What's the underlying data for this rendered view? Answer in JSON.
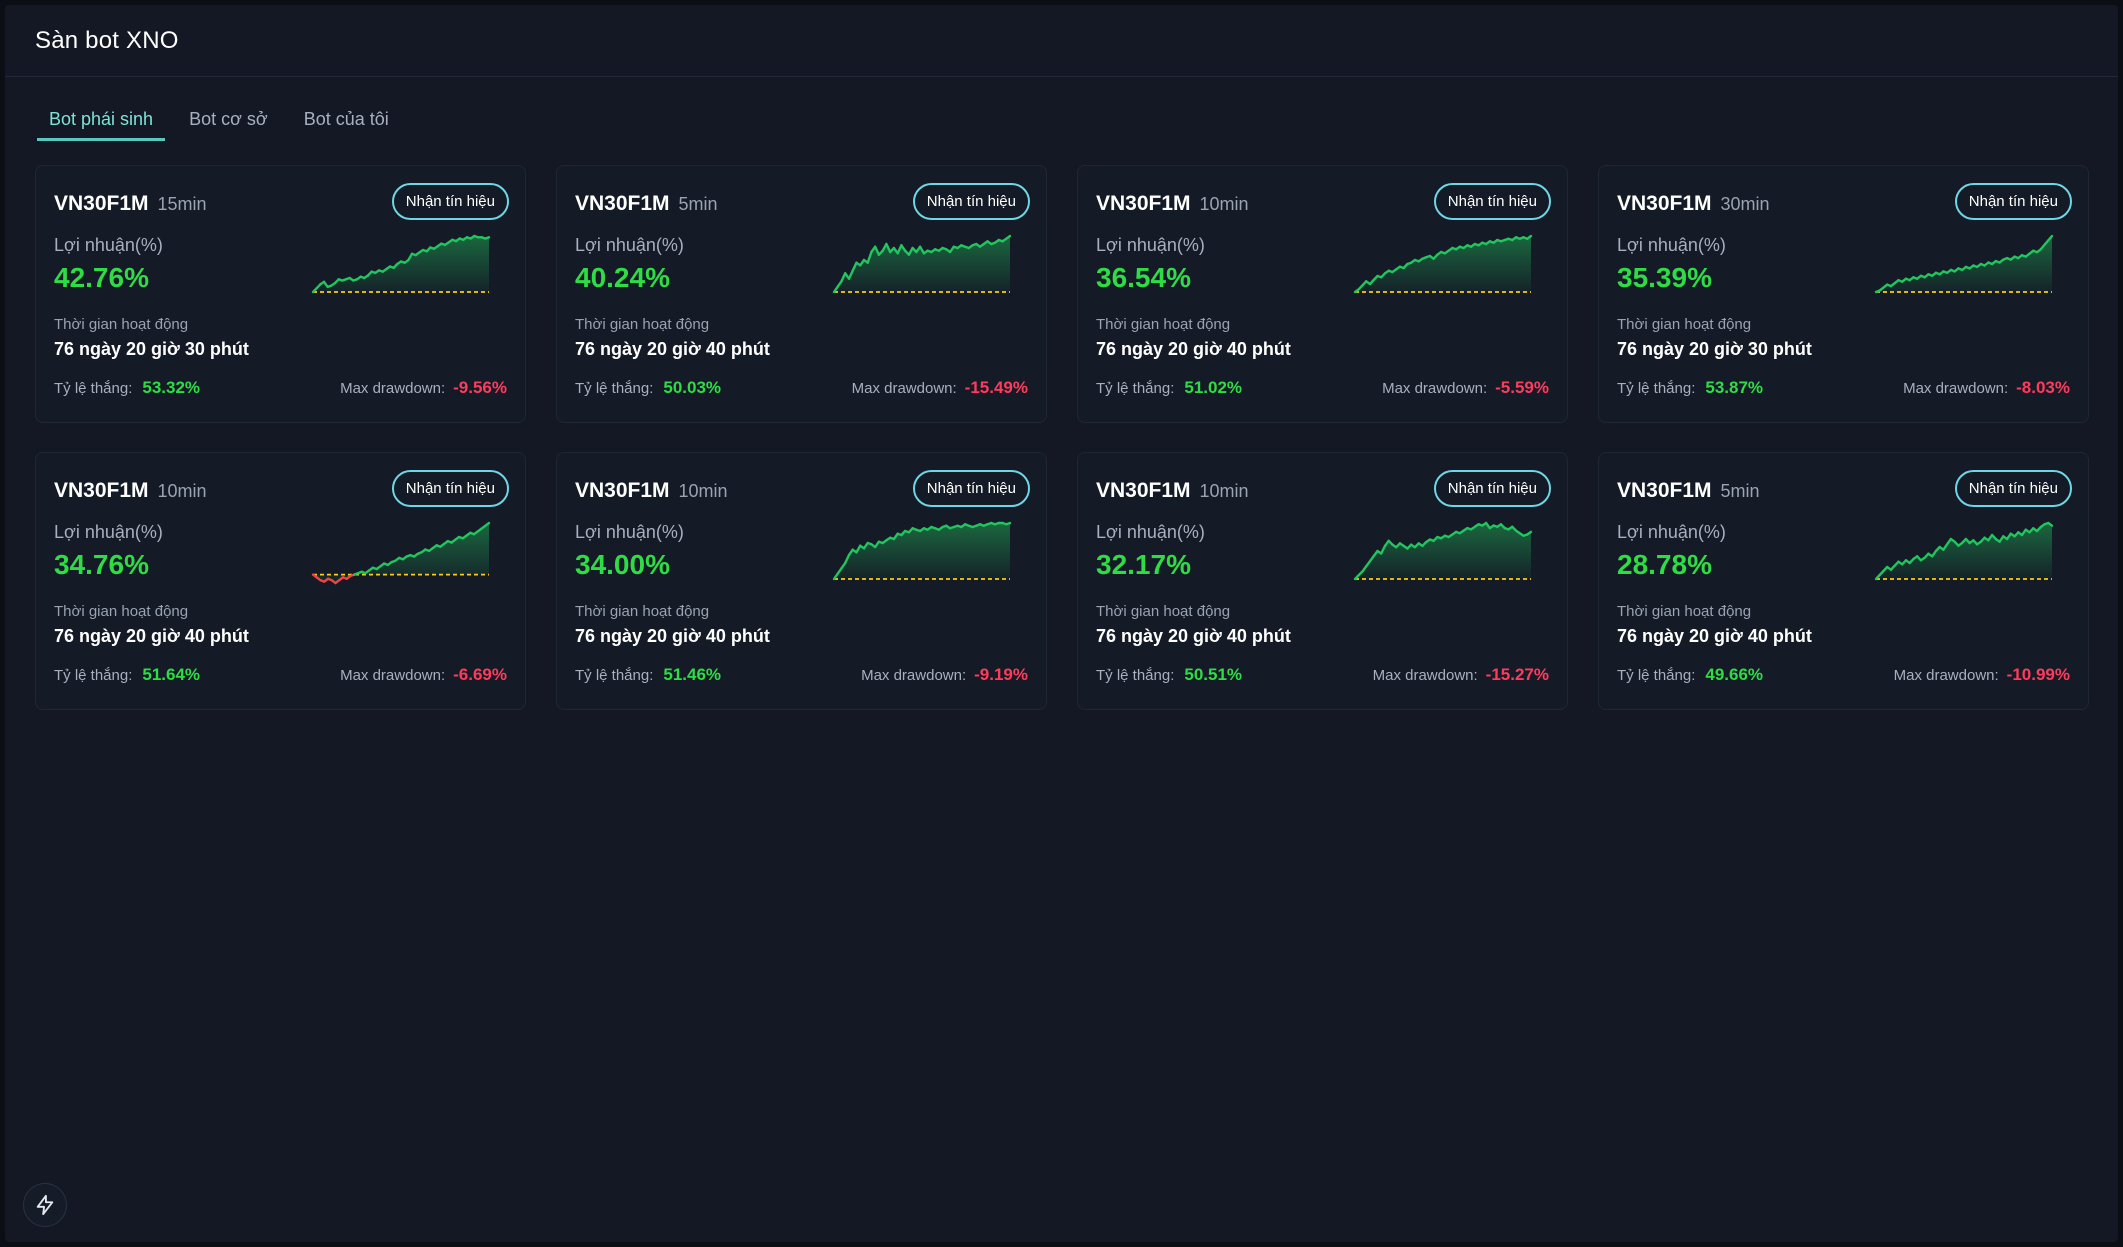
{
  "header": {
    "title": "Sàn bot XNO"
  },
  "tabs": [
    {
      "label": "Bot phái sinh",
      "active": true
    },
    {
      "label": "Bot cơ sở",
      "active": false
    },
    {
      "label": "Bot của tôi",
      "active": false
    }
  ],
  "labels": {
    "signal_button": "Nhận tín hiệu",
    "profit": "Lợi nhuận(%)",
    "runtime": "Thời gian hoạt động",
    "win_rate": "Tỷ lệ thắng:",
    "max_drawdown": "Max drawdown:"
  },
  "colors": {
    "profit_positive": "#2fdc45",
    "drawdown": "#ff3b5c",
    "tab_active": "#7fe3d8",
    "button_border": "#6fd6e6",
    "sparkline_up": "#22c55e",
    "sparkline_down": "#ef4444",
    "baseline": "#facc15"
  },
  "bots": [
    {
      "symbol": "VN30F1M",
      "interval": "15min",
      "profit": "42.76%",
      "runtime": "76 ngày 20 giờ 30 phút",
      "win_rate": "53.32%",
      "max_drawdown": "-9.56%",
      "spark": [
        0,
        3,
        6,
        8,
        4,
        5,
        7,
        10,
        9,
        10,
        11,
        9,
        10,
        12,
        11,
        13,
        16,
        15,
        17,
        16,
        18,
        20,
        19,
        22,
        24,
        23,
        25,
        30,
        29,
        31,
        33,
        32,
        35,
        34,
        36,
        38,
        37,
        39,
        41,
        40,
        42,
        41,
        43,
        42,
        44,
        43,
        43,
        42,
        43
      ]
    },
    {
      "symbol": "VN30F1M",
      "interval": "5min",
      "profit": "40.24%",
      "runtime": "76 ngày 20 giờ 40 phút",
      "win_rate": "50.03%",
      "max_drawdown": "-15.49%",
      "spark": [
        0,
        4,
        8,
        14,
        10,
        16,
        22,
        20,
        24,
        22,
        30,
        34,
        28,
        31,
        36,
        30,
        33,
        29,
        35,
        31,
        28,
        33,
        30,
        34,
        29,
        31,
        30,
        32,
        31,
        33,
        32,
        30,
        34,
        33,
        35,
        34,
        33,
        35,
        36,
        34,
        36,
        38,
        36,
        37,
        39,
        38,
        40,
        42
      ]
    },
    {
      "symbol": "VN30F1M",
      "interval": "10min",
      "profit": "36.54%",
      "runtime": "76 ngày 20 giờ 40 phút",
      "win_rate": "51.02%",
      "max_drawdown": "-5.59%",
      "spark": [
        0,
        2,
        5,
        8,
        6,
        9,
        12,
        11,
        14,
        16,
        15,
        17,
        19,
        18,
        21,
        22,
        24,
        23,
        25,
        26,
        27,
        25,
        28,
        30,
        29,
        31,
        33,
        32,
        34,
        33,
        35,
        34,
        36,
        35,
        37,
        36,
        38,
        37,
        39,
        38,
        39,
        40,
        39,
        41,
        40,
        41,
        40,
        42
      ]
    },
    {
      "symbol": "VN30F1M",
      "interval": "30min",
      "profit": "35.39%",
      "runtime": "76 ngày 20 giờ 30 phút",
      "win_rate": "53.87%",
      "max_drawdown": "-8.03%",
      "spark": [
        0,
        1,
        3,
        5,
        4,
        6,
        8,
        7,
        9,
        8,
        10,
        9,
        11,
        10,
        12,
        11,
        13,
        12,
        14,
        13,
        15,
        14,
        16,
        15,
        17,
        16,
        18,
        17,
        19,
        18,
        20,
        19,
        21,
        20,
        22,
        23,
        22,
        24,
        23,
        25,
        24,
        26,
        28,
        27,
        29,
        32,
        35,
        38
      ]
    },
    {
      "symbol": "VN30F1M",
      "interval": "10min",
      "profit": "34.76%",
      "runtime": "76 ngày 20 giờ 40 phút",
      "win_rate": "51.64%",
      "max_drawdown": "-6.69%",
      "spark": [
        0,
        -2,
        -4,
        -5,
        -3,
        -4,
        -6,
        -4,
        -2,
        -3,
        -1,
        0,
        1,
        2,
        1,
        3,
        5,
        4,
        6,
        8,
        7,
        9,
        10,
        12,
        11,
        13,
        14,
        13,
        15,
        16,
        18,
        17,
        19,
        21,
        20,
        22,
        24,
        23,
        25,
        27,
        26,
        28,
        30,
        29,
        31,
        33,
        35,
        37
      ]
    },
    {
      "symbol": "VN30F1M",
      "interval": "10min",
      "profit": "34.00%",
      "runtime": "76 ngày 20 giờ 40 phút",
      "win_rate": "51.46%",
      "max_drawdown": "-9.19%",
      "spark": [
        0,
        4,
        8,
        12,
        18,
        22,
        20,
        25,
        23,
        27,
        26,
        24,
        28,
        27,
        29,
        31,
        30,
        34,
        33,
        36,
        35,
        38,
        37,
        36,
        38,
        37,
        39,
        38,
        37,
        39,
        40,
        38,
        39,
        40,
        39,
        41,
        40,
        39,
        40,
        41,
        40,
        41,
        42,
        41,
        42,
        42,
        41,
        42
      ]
    },
    {
      "symbol": "VN30F1M",
      "interval": "10min",
      "profit": "32.17%",
      "runtime": "76 ngày 20 giờ 40 phút",
      "win_rate": "50.51%",
      "max_drawdown": "-15.27%",
      "spark": [
        0,
        3,
        6,
        10,
        14,
        18,
        22,
        20,
        26,
        30,
        27,
        25,
        28,
        26,
        24,
        27,
        25,
        28,
        26,
        29,
        31,
        30,
        33,
        32,
        34,
        33,
        35,
        37,
        36,
        38,
        40,
        39,
        41,
        43,
        42,
        44,
        40,
        42,
        41,
        43,
        40,
        39,
        41,
        38,
        36,
        34,
        35,
        37
      ]
    },
    {
      "symbol": "VN30F1M",
      "interval": "5min",
      "profit": "28.78%",
      "runtime": "76 ngày 20 giờ 40 phút",
      "win_rate": "49.66%",
      "max_drawdown": "-10.99%",
      "spark": [
        0,
        3,
        6,
        9,
        7,
        10,
        13,
        11,
        14,
        12,
        15,
        17,
        14,
        16,
        19,
        17,
        21,
        24,
        22,
        26,
        30,
        28,
        25,
        27,
        30,
        27,
        29,
        26,
        28,
        31,
        29,
        33,
        30,
        28,
        32,
        30,
        34,
        32,
        35,
        33,
        37,
        35,
        38,
        36,
        39,
        41,
        42,
        40
      ]
    }
  ]
}
